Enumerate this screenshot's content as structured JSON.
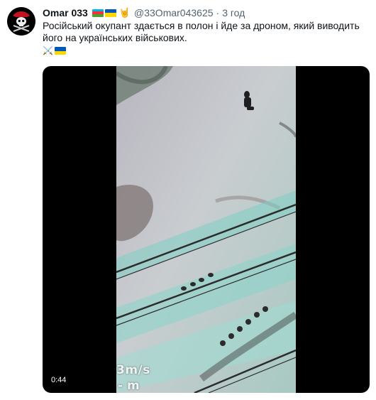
{
  "tweet": {
    "display_name": "Omar 033",
    "handle": "@33Omar043625",
    "separator": "·",
    "time": "3 год",
    "text_line1": "Російський окупант здається в полон і йде за дроном, який виводить",
    "text_line2": "його на українських військових.",
    "emoji_swords": "⚔️"
  },
  "video": {
    "duration": "0:44",
    "overlay_speed": "3m/s",
    "overlay_alt": "- m"
  },
  "colors": {
    "text_primary": "#0f1419",
    "text_secondary": "#536471",
    "video_bg": "#000000",
    "az_blue": "#00b5e2",
    "az_red": "#ef3340",
    "az_green": "#509e2f",
    "ua_blue": "#0057b7",
    "ua_yellow": "#ffd700"
  },
  "icons": {
    "avatar": "pirate-skull-avatar",
    "hand": "rock-on-hand-emoji"
  }
}
